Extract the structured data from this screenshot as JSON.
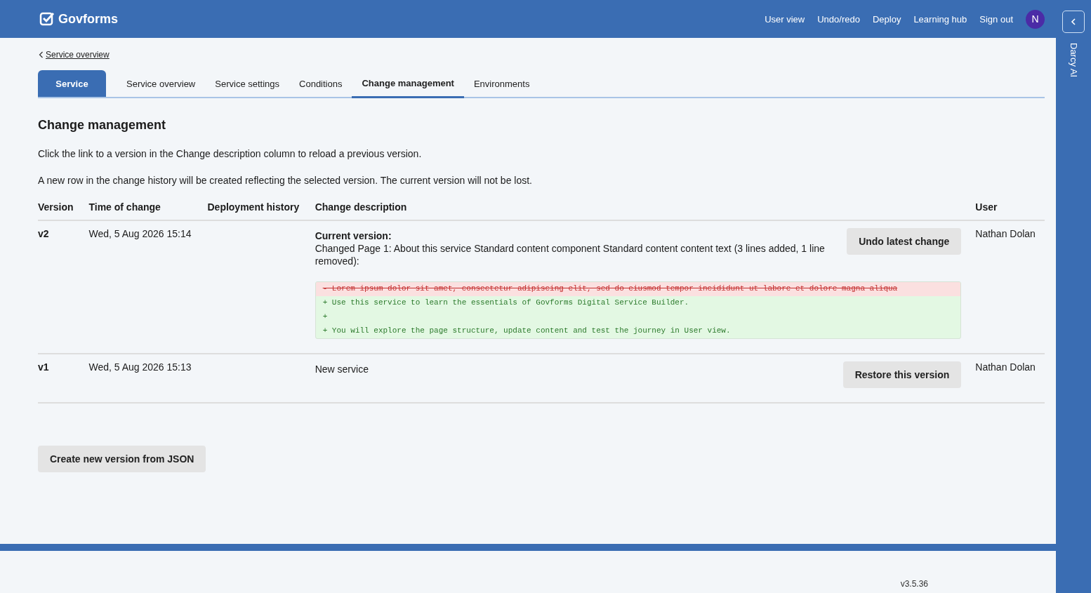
{
  "header": {
    "logo": "Govforms",
    "nav": [
      "User view",
      "Undo/redo",
      "Deploy",
      "Learning hub",
      "Sign out"
    ],
    "avatar": "N"
  },
  "side_panel": {
    "title": "Darcy AI"
  },
  "breadcrumb": "Service overview",
  "tabs": [
    {
      "label": "Service",
      "kind": "primary",
      "selected": false
    },
    {
      "label": "Service overview",
      "kind": "plain",
      "selected": false
    },
    {
      "label": "Service settings",
      "kind": "plain",
      "selected": false
    },
    {
      "label": "Conditions",
      "kind": "plain",
      "selected": false
    },
    {
      "label": "Change management",
      "kind": "plain",
      "selected": true
    },
    {
      "label": "Environments",
      "kind": "plain",
      "selected": false
    }
  ],
  "heading": "Change management",
  "intro": [
    "Click the link to a version in the Change description column to reload a previous version.",
    "A new row in the change history will be created reflecting the selected version. The current version will not be lost."
  ],
  "table": {
    "columns": [
      "Version",
      "Time of change",
      "Deployment history",
      "Change description",
      "User"
    ],
    "rows": [
      {
        "version": "v2",
        "time": "Wed, 5 Aug 2026 15:14",
        "description_title": "Current version:",
        "description": "Changed Page 1: About this service Standard content component Standard content content text (3 lines added, 1 line removed):",
        "diff": [
          {
            "kind": "removed",
            "text": "- Lorem ipsum dolor sit amet, consectetur adipiscing elit, sed do eiusmod tempor incididunt ut labore et dolore magna aliqua"
          },
          {
            "kind": "added",
            "text": "+ Use this service to learn the essentials of Govforms Digital Service Builder."
          },
          {
            "kind": "added",
            "text": "+"
          },
          {
            "kind": "added",
            "text": "+ You will explore the page structure, update content and test the journey in User view."
          }
        ],
        "action": "Undo latest change",
        "user": "Nathan Dolan"
      },
      {
        "version": "v1",
        "time": "Wed, 5 Aug 2026 15:13",
        "description": "New service",
        "action": "Restore this version",
        "user": "Nathan Dolan"
      }
    ]
  },
  "create_button": "Create new version from JSON",
  "footer": {
    "version": "v3.5.36"
  }
}
